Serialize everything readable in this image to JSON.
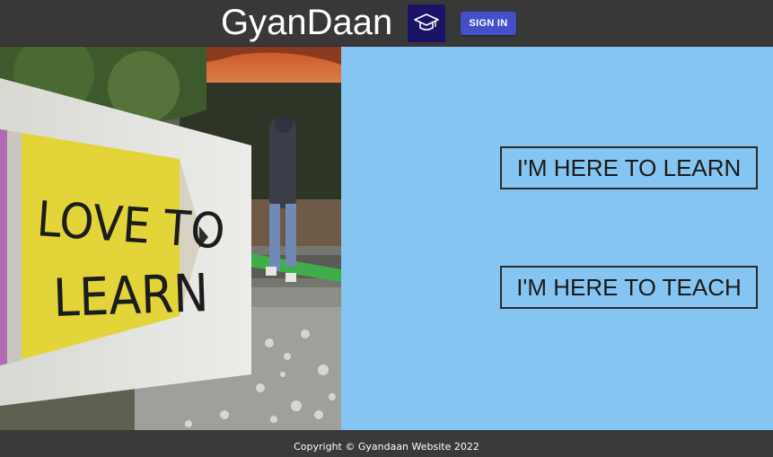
{
  "header": {
    "brand_name": "GyanDaan",
    "logo_icon": "graduation-cap-icon",
    "signin_label": "SIGN IN"
  },
  "hero": {
    "sign_text_line1": "LOVE TO",
    "sign_text_line2": "LEARN"
  },
  "actions": {
    "learn_label": "I'M HERE TO LEARN",
    "teach_label": "I'M HERE TO TEACH"
  },
  "footer": {
    "copyright": "Copyright © Gyandaan Website 2022"
  },
  "colors": {
    "header_bg": "#383838",
    "logo_bg": "#1a1366",
    "signin_bg": "#4350c9",
    "panel_bg": "#86c4f1"
  }
}
